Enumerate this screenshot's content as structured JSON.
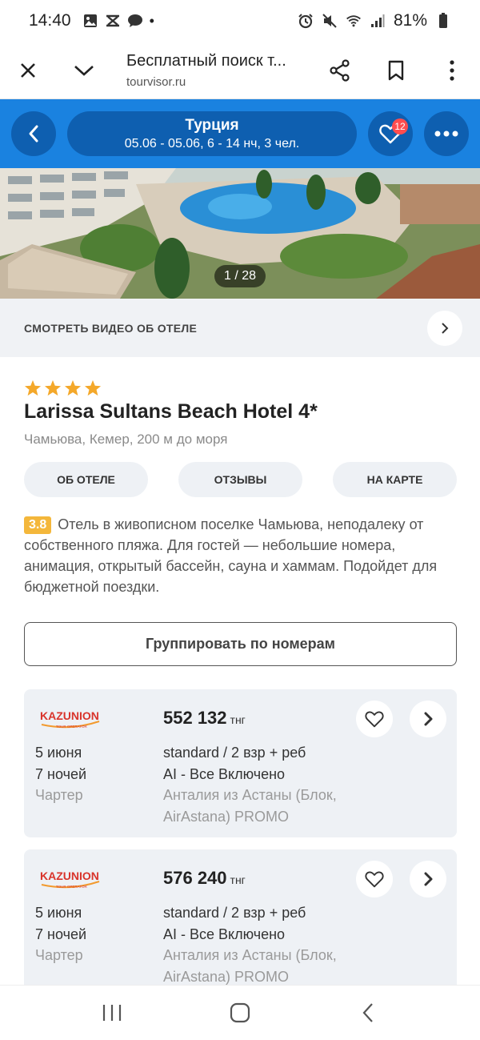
{
  "status_bar": {
    "time": "14:40",
    "dot": "•",
    "battery": "81%",
    "icons_left": [
      "image-icon",
      "missed-call-icon",
      "chat-icon"
    ],
    "icons_right": [
      "alarm-icon",
      "mute-icon",
      "wifi-icon",
      "signal-icon",
      "battery-icon"
    ]
  },
  "browser": {
    "title": "Бесплатный поиск т...",
    "url": "tourvisor.ru"
  },
  "header": {
    "country": "Турция",
    "details": "05.06 - 05.06, 6 - 14 нч, 3 чел.",
    "favorites_count": "12",
    "accent_color": "#1a82e0"
  },
  "gallery": {
    "counter": "1 / 28"
  },
  "video": {
    "label": "СМОТРЕТЬ ВИДЕО ОБ ОТЕЛЕ"
  },
  "hotel": {
    "stars": 4,
    "name": "Larissa Sultans Beach Hotel 4*",
    "location": "Чамьюва, Кемер, 200 м до моря",
    "tabs": [
      "ОБ ОТЕЛЕ",
      "ОТЗЫВЫ",
      "НА КАРТЕ"
    ],
    "rating": "3.8",
    "description": "Отель в живописном поселке Чамьюва, неподалеку от собственного пляжа. Для гостей — небольшие номера, анимация, открытый бассейн, сауна и хаммам. Подойдет для бюджетной поездки."
  },
  "group_button": "Группировать по номерам",
  "offers": [
    {
      "operator": "KAZUNION",
      "operator_sub": "TOUR OPERATOR",
      "price": "552 132",
      "currency": "тнг",
      "date": "5 июня",
      "nights": "7 ночей",
      "flight_type": "Чартер",
      "room": "standard / 2 взр + реб",
      "meal": "AI - Все Включено",
      "flight": "Анталия из Астаны (Блок, AirAstana) PROMO"
    },
    {
      "operator": "KAZUNION",
      "operator_sub": "TOUR OPERATOR",
      "price": "576 240",
      "currency": "тнг",
      "date": "5 июня",
      "nights": "7 ночей",
      "flight_type": "Чартер",
      "room": "standard / 2 взр + реб",
      "meal": "AI - Все Включено",
      "flight": "Анталия из Астаны (Блок, AirAstana) PROMO"
    }
  ],
  "navbar": [
    "recent-apps-icon",
    "home-icon",
    "back-icon"
  ]
}
